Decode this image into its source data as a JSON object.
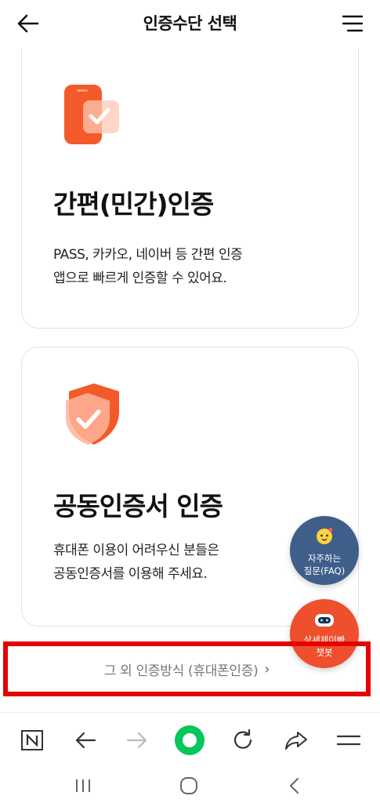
{
  "header": {
    "title": "인증수단 선택",
    "back_icon": "arrow-left-icon",
    "menu_icon": "hamburger-menu-icon"
  },
  "cards": [
    {
      "icon": "phone-check-icon",
      "title": "간편(민간)인증",
      "desc_line1": "PASS, 카카오, 네이버 등 간편 인증",
      "desc_line2": "앱으로 빠르게 인증할 수 있어요."
    },
    {
      "icon": "shield-check-icon",
      "title": "공동인증서 인증",
      "desc_line1": "휴대폰 이용이 어려우신 분들은",
      "desc_line2": "공동인증서를 이용해 주세요."
    }
  ],
  "fabs": {
    "faq_line1": "자주하는",
    "faq_line2": "질문(FAQ)",
    "chat_line1": "상세제이빠",
    "chat_line2": "챗봇"
  },
  "other_method": {
    "label": "그 외 인증방식 (휴대폰인증)",
    "chevron": "›"
  },
  "colors": {
    "accent_orange": "#ee4f2c",
    "faq_blue": "#3f5f8a",
    "highlight_red": "#e60000",
    "browser_green": "#03c75a"
  },
  "browser_bar_icons": [
    "naver-n-icon",
    "back-arrow-icon",
    "forward-arrow-icon",
    "naver-green-dot-icon",
    "refresh-icon",
    "share-icon",
    "menu-icon"
  ],
  "system_nav_icons": [
    "recent-apps-icon",
    "home-icon",
    "back-icon"
  ]
}
